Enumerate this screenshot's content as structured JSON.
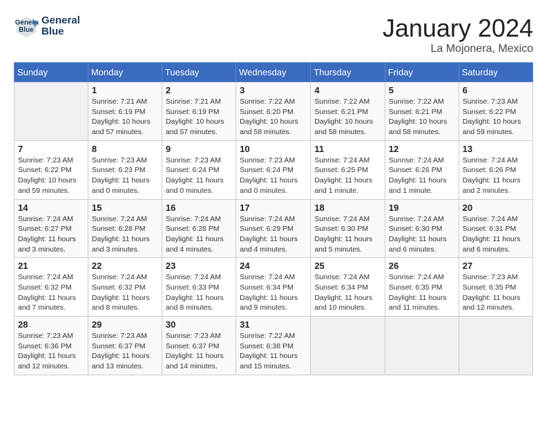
{
  "header": {
    "logo_line1": "General",
    "logo_line2": "Blue",
    "title": "January 2024",
    "subtitle": "La Mojonera, Mexico"
  },
  "calendar": {
    "days_of_week": [
      "Sunday",
      "Monday",
      "Tuesday",
      "Wednesday",
      "Thursday",
      "Friday",
      "Saturday"
    ],
    "weeks": [
      [
        {
          "day": "",
          "info": ""
        },
        {
          "day": "1",
          "info": "Sunrise: 7:21 AM\nSunset: 6:19 PM\nDaylight: 10 hours\nand 57 minutes."
        },
        {
          "day": "2",
          "info": "Sunrise: 7:21 AM\nSunset: 6:19 PM\nDaylight: 10 hours\nand 57 minutes."
        },
        {
          "day": "3",
          "info": "Sunrise: 7:22 AM\nSunset: 6:20 PM\nDaylight: 10 hours\nand 58 minutes."
        },
        {
          "day": "4",
          "info": "Sunrise: 7:22 AM\nSunset: 6:21 PM\nDaylight: 10 hours\nand 58 minutes."
        },
        {
          "day": "5",
          "info": "Sunrise: 7:22 AM\nSunset: 6:21 PM\nDaylight: 10 hours\nand 58 minutes."
        },
        {
          "day": "6",
          "info": "Sunrise: 7:23 AM\nSunset: 6:22 PM\nDaylight: 10 hours\nand 59 minutes."
        }
      ],
      [
        {
          "day": "7",
          "info": "Sunrise: 7:23 AM\nSunset: 6:22 PM\nDaylight: 10 hours\nand 59 minutes."
        },
        {
          "day": "8",
          "info": "Sunrise: 7:23 AM\nSunset: 6:23 PM\nDaylight: 11 hours\nand 0 minutes."
        },
        {
          "day": "9",
          "info": "Sunrise: 7:23 AM\nSunset: 6:24 PM\nDaylight: 11 hours\nand 0 minutes."
        },
        {
          "day": "10",
          "info": "Sunrise: 7:23 AM\nSunset: 6:24 PM\nDaylight: 11 hours\nand 0 minutes."
        },
        {
          "day": "11",
          "info": "Sunrise: 7:24 AM\nSunset: 6:25 PM\nDaylight: 11 hours\nand 1 minute."
        },
        {
          "day": "12",
          "info": "Sunrise: 7:24 AM\nSunset: 6:26 PM\nDaylight: 11 hours\nand 1 minute."
        },
        {
          "day": "13",
          "info": "Sunrise: 7:24 AM\nSunset: 6:26 PM\nDaylight: 11 hours\nand 2 minutes."
        }
      ],
      [
        {
          "day": "14",
          "info": "Sunrise: 7:24 AM\nSunset: 6:27 PM\nDaylight: 11 hours\nand 3 minutes."
        },
        {
          "day": "15",
          "info": "Sunrise: 7:24 AM\nSunset: 6:28 PM\nDaylight: 11 hours\nand 3 minutes."
        },
        {
          "day": "16",
          "info": "Sunrise: 7:24 AM\nSunset: 6:28 PM\nDaylight: 11 hours\nand 4 minutes."
        },
        {
          "day": "17",
          "info": "Sunrise: 7:24 AM\nSunset: 6:29 PM\nDaylight: 11 hours\nand 4 minutes."
        },
        {
          "day": "18",
          "info": "Sunrise: 7:24 AM\nSunset: 6:30 PM\nDaylight: 11 hours\nand 5 minutes."
        },
        {
          "day": "19",
          "info": "Sunrise: 7:24 AM\nSunset: 6:30 PM\nDaylight: 11 hours\nand 6 minutes."
        },
        {
          "day": "20",
          "info": "Sunrise: 7:24 AM\nSunset: 6:31 PM\nDaylight: 11 hours\nand 6 minutes."
        }
      ],
      [
        {
          "day": "21",
          "info": "Sunrise: 7:24 AM\nSunset: 6:32 PM\nDaylight: 11 hours\nand 7 minutes."
        },
        {
          "day": "22",
          "info": "Sunrise: 7:24 AM\nSunset: 6:32 PM\nDaylight: 11 hours\nand 8 minutes."
        },
        {
          "day": "23",
          "info": "Sunrise: 7:24 AM\nSunset: 6:33 PM\nDaylight: 11 hours\nand 8 minutes."
        },
        {
          "day": "24",
          "info": "Sunrise: 7:24 AM\nSunset: 6:34 PM\nDaylight: 11 hours\nand 9 minutes."
        },
        {
          "day": "25",
          "info": "Sunrise: 7:24 AM\nSunset: 6:34 PM\nDaylight: 11 hours\nand 10 minutes."
        },
        {
          "day": "26",
          "info": "Sunrise: 7:24 AM\nSunset: 6:35 PM\nDaylight: 11 hours\nand 11 minutes."
        },
        {
          "day": "27",
          "info": "Sunrise: 7:23 AM\nSunset: 6:35 PM\nDaylight: 11 hours\nand 12 minutes."
        }
      ],
      [
        {
          "day": "28",
          "info": "Sunrise: 7:23 AM\nSunset: 6:36 PM\nDaylight: 11 hours\nand 12 minutes."
        },
        {
          "day": "29",
          "info": "Sunrise: 7:23 AM\nSunset: 6:37 PM\nDaylight: 11 hours\nand 13 minutes."
        },
        {
          "day": "30",
          "info": "Sunrise: 7:23 AM\nSunset: 6:37 PM\nDaylight: 11 hours\nand 14 minutes."
        },
        {
          "day": "31",
          "info": "Sunrise: 7:22 AM\nSunset: 6:38 PM\nDaylight: 11 hours\nand 15 minutes."
        },
        {
          "day": "",
          "info": ""
        },
        {
          "day": "",
          "info": ""
        },
        {
          "day": "",
          "info": ""
        }
      ]
    ]
  }
}
